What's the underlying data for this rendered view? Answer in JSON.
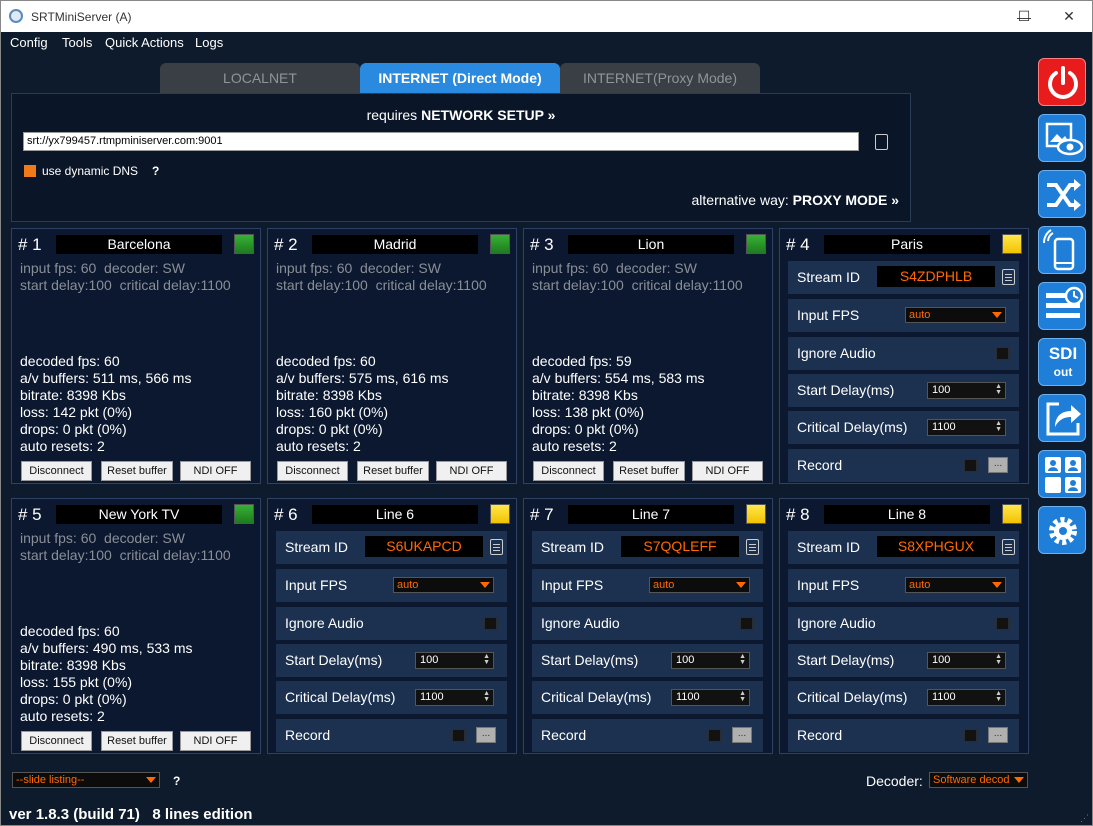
{
  "window": {
    "title": "SRTMiniServer (A)",
    "minimize": "—",
    "maximize": "☐",
    "close": "✕"
  },
  "menu": [
    "Config",
    "Tools",
    "Quick Actions",
    "Logs"
  ],
  "tabs": [
    {
      "label": "LOCALNET",
      "active": false
    },
    {
      "label": "INTERNET (Direct Mode)",
      "active": true
    },
    {
      "label": "INTERNET(Proxy Mode)",
      "active": false
    }
  ],
  "panel": {
    "requires_prefix": "requires",
    "network_setup_link": "NETWORK SETUP »",
    "srt_url": "srt://yx799457.rtmpminiserver.com:9001",
    "dynamic_dns_label": "use dynamic DNS",
    "help": "?",
    "alt_prefix": "alternative way:",
    "proxy_mode_link": "PROXY MODE »"
  },
  "labels": {
    "stream_id": "Stream ID",
    "input_fps": "Input FPS",
    "ignore_audio": "Ignore Audio",
    "start_delay": "Start Delay(ms)",
    "critical_delay": "Critical Delay(ms)",
    "record": "Record",
    "disconnect": "Disconnect",
    "reset_buffer": "Reset buffer",
    "ndi_off": "NDI OFF",
    "dots": "..."
  },
  "cards": [
    {
      "num": "# 1",
      "name": "Barcelona",
      "status": "green",
      "info1": "input fps: 60  decoder: SW",
      "info2": "start delay:100  critical delay:1100",
      "stats": [
        "decoded fps: 60",
        "a/v buffers: 511 ms, 566 ms",
        "bitrate: 8398 Kbs",
        "loss: 142 pkt (0%)",
        "drops: 0 pkt (0%)",
        "auto resets: 2"
      ]
    },
    {
      "num": "# 2",
      "name": "Madrid",
      "status": "green",
      "info1": "input fps: 60  decoder: SW",
      "info2": "start delay:100  critical delay:1100",
      "stats": [
        "decoded fps: 60",
        "a/v buffers: 575 ms, 616 ms",
        "bitrate: 8398 Kbs",
        "loss: 160 pkt (0%)",
        "drops: 0 pkt (0%)",
        "auto resets: 2"
      ]
    },
    {
      "num": "# 3",
      "name": "Lion",
      "status": "green",
      "info1": "input fps: 60  decoder: SW",
      "info2": "start delay:100  critical delay:1100",
      "stats": [
        "decoded fps: 59",
        "a/v buffers: 554 ms, 583 ms",
        "bitrate: 8398 Kbs",
        "loss: 138 pkt (0%)",
        "drops: 0 pkt (0%)",
        "auto resets: 2"
      ]
    },
    {
      "num": "# 4",
      "name": "Paris",
      "status": "yellow",
      "stream_id": "S4ZDPHLB",
      "fps": "auto",
      "start_delay": "100",
      "critical_delay": "1100"
    },
    {
      "num": "# 5",
      "name": "New York TV",
      "status": "green",
      "info1": "input fps: 60  decoder: SW",
      "info2": "start delay:100  critical delay:1100",
      "stats": [
        "decoded fps: 60",
        "a/v buffers: 490 ms, 533 ms",
        "bitrate: 8398 Kbs",
        "loss: 155 pkt (0%)",
        "drops: 0 pkt (0%)",
        "auto resets: 2"
      ]
    },
    {
      "num": "# 6",
      "name": "Line 6",
      "status": "yellow",
      "stream_id": "S6UKAPCD",
      "fps": "auto",
      "start_delay": "100",
      "critical_delay": "1100"
    },
    {
      "num": "# 7",
      "name": "Line 7",
      "status": "yellow",
      "stream_id": "S7QQLEFF",
      "fps": "auto",
      "start_delay": "100",
      "critical_delay": "1100"
    },
    {
      "num": "# 8",
      "name": "Line 8",
      "status": "yellow",
      "stream_id": "S8XPHGUX",
      "fps": "auto",
      "start_delay": "100",
      "critical_delay": "1100"
    }
  ],
  "sidebar": {
    "sdi_top": "SDI",
    "sdi_bottom": "out",
    "icons": [
      "power-icon",
      "preview-icon",
      "shuffle-icon",
      "mobile-icon",
      "schedule-icon",
      "sdi-out-icon",
      "share-icon",
      "users-icon",
      "gear-icon"
    ]
  },
  "footer": {
    "slide_listing": "--slide listing--",
    "help": "?",
    "decoder_label": "Decoder:",
    "decoder_value": "Software decod",
    "version": "ver 1.8.3 (build 71)   8 lines edition"
  },
  "colors": {
    "accent_orange": "#ff6a00",
    "active_tab": "#2a8ae0",
    "status_green": "#2a9a2a",
    "status_yellow": "#ffd800",
    "power_red": "#e81c1c",
    "sidebar_blue": "#1f7fd8"
  }
}
